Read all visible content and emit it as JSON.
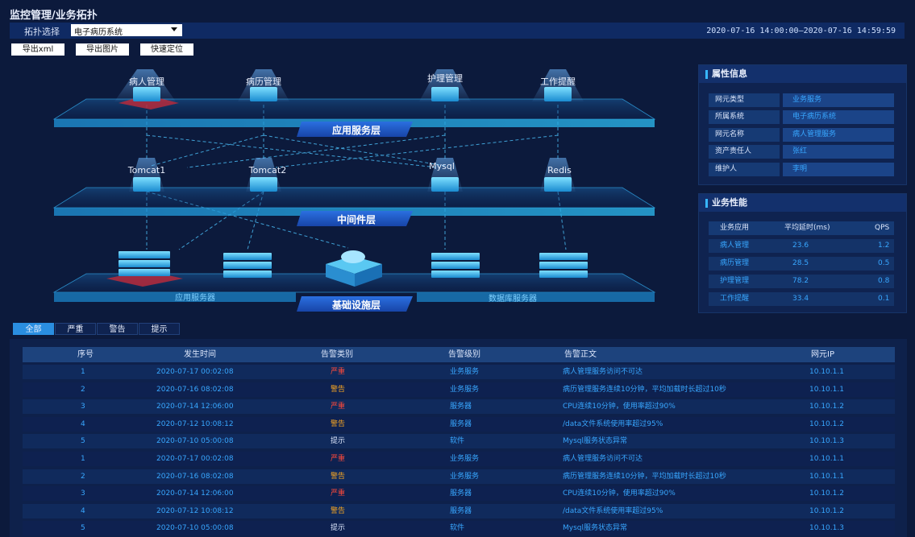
{
  "page": {
    "title": "监控管理/业务拓扑"
  },
  "toolbar": {
    "topo_label": "拓扑选择",
    "topo_select_value": "电子病历系统",
    "time_range": "2020-07-16  14:00:00—2020-07-16  14:59:59",
    "export_xml": "导出xml",
    "export_image": "导出图片",
    "quick_locate": "快速定位"
  },
  "topology": {
    "layers": {
      "app": "应用服务层",
      "middleware": "中间件层",
      "infra": "基础设施层"
    },
    "app_nodes": [
      "病人管理",
      "病历管理",
      "护理管理",
      "工作提醒"
    ],
    "middleware_nodes": [
      "Tomcat1",
      "Tomcat2",
      "Mysql",
      "Redis"
    ],
    "infra_labels": {
      "app_servers": "应用服务器",
      "db_servers": "数据库服务器"
    }
  },
  "properties": {
    "title": "属性信息",
    "rows": [
      {
        "key": "网元类型",
        "value": "业务服务"
      },
      {
        "key": "所属系统",
        "value": "电子病历系统"
      },
      {
        "key": "网元名称",
        "value": "病人管理服务"
      },
      {
        "key": "资产责任人",
        "value": "张红"
      },
      {
        "key": "维护人",
        "value": "李明"
      }
    ]
  },
  "performance": {
    "title": "业务性能",
    "headers": [
      "业务应用",
      "平均延时(ms)",
      "QPS"
    ],
    "rows": [
      [
        "病人管理",
        "23.6",
        "1.2"
      ],
      [
        "病历管理",
        "28.5",
        "0.5"
      ],
      [
        "护理管理",
        "78.2",
        "0.8"
      ],
      [
        "工作提醒",
        "33.4",
        "0.1"
      ]
    ]
  },
  "tabs": [
    "全部",
    "严重",
    "警告",
    "提示"
  ],
  "alarms": {
    "headers": [
      "序号",
      "发生时间",
      "告警类别",
      "告警级别",
      "告警正文",
      "网元IP"
    ],
    "rows": [
      [
        "1",
        "2020-07-17 00:02:08",
        "严重",
        "业务服务",
        "病人管理服务访问不可达",
        "10.10.1.1"
      ],
      [
        "2",
        "2020-07-16 08:02:08",
        "警告",
        "业务服务",
        "病历管理服务连续10分钟，平均加载时长超过10秒",
        "10.10.1.1"
      ],
      [
        "3",
        "2020-07-14 12:06:00",
        "严重",
        "服务器",
        "CPU连续10分钟，使用率超过90%",
        "10.10.1.2"
      ],
      [
        "4",
        "2020-07-12 10:08:12",
        "警告",
        "服务器",
        "/data文件系统使用率超过95%",
        "10.10.1.2"
      ],
      [
        "5",
        "2020-07-10 05:00:08",
        "提示",
        "软件",
        "Mysql服务状态异常",
        "10.10.1.3"
      ],
      [
        "1",
        "2020-07-17 00:02:08",
        "严重",
        "业务服务",
        "病人管理服务访问不可达",
        "10.10.1.1"
      ],
      [
        "2",
        "2020-07-16 08:02:08",
        "警告",
        "业务服务",
        "病历管理服务连续10分钟，平均加载时长超过10秒",
        "10.10.1.1"
      ],
      [
        "3",
        "2020-07-14 12:06:00",
        "严重",
        "服务器",
        "CPU连续10分钟，使用率超过90%",
        "10.10.1.2"
      ],
      [
        "4",
        "2020-07-12 10:08:12",
        "警告",
        "服务器",
        "/data文件系统使用率超过95%",
        "10.10.1.2"
      ],
      [
        "5",
        "2020-07-10 05:00:08",
        "提示",
        "软件",
        "Mysql服务状态异常",
        "10.10.1.3"
      ]
    ]
  }
}
